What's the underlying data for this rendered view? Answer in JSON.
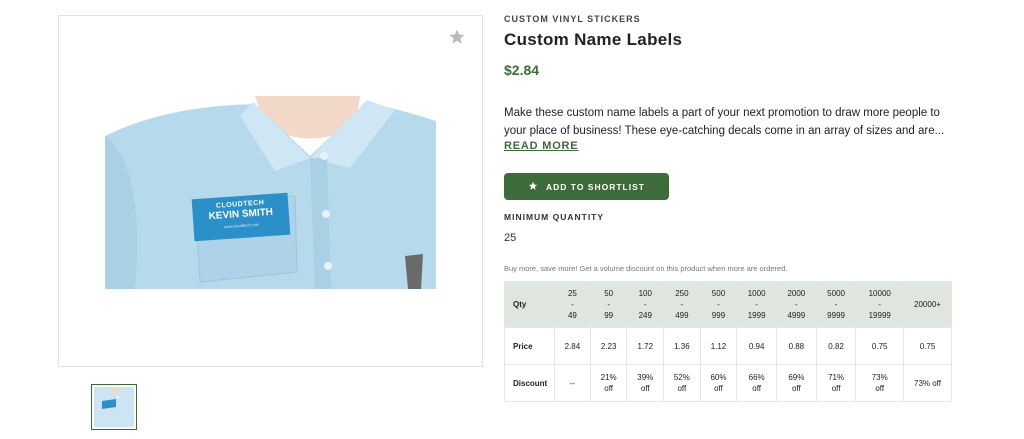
{
  "product": {
    "category": "CUSTOM VINYL STICKERS",
    "title": "Custom Name Labels",
    "price": "$2.84",
    "description_line1": "Make these custom name labels a part of your next promotion to draw more people to",
    "description_line2": "your place of business! These eye-catching decals come in an array of sizes and are...",
    "read_more": "READ MORE",
    "shortlist_label": "ADD TO SHORTLIST",
    "min_qty_label": "MINIMUM QUANTITY",
    "min_qty_value": "25",
    "volume_note": "Buy more, save more! Get a volume discount on this product when more are ordered."
  },
  "label_art": {
    "brand": "CLOUDTECH",
    "name": "KEVIN SMITH",
    "url": "www.cloudtech.com"
  },
  "pricing": {
    "headers": {
      "row_qty": "Qty",
      "row_price": "Price",
      "row_discount": "Discount"
    },
    "columns": [
      {
        "qty_a": "25",
        "qty_sep": "-",
        "qty_b": "49",
        "price": "2.84",
        "discount_a": "--",
        "discount_b": ""
      },
      {
        "qty_a": "50",
        "qty_sep": "-",
        "qty_b": "99",
        "price": "2.23",
        "discount_a": "21%",
        "discount_b": "off"
      },
      {
        "qty_a": "100",
        "qty_sep": "-",
        "qty_b": "249",
        "price": "1.72",
        "discount_a": "39%",
        "discount_b": "off"
      },
      {
        "qty_a": "250",
        "qty_sep": "-",
        "qty_b": "499",
        "price": "1.36",
        "discount_a": "52%",
        "discount_b": "off"
      },
      {
        "qty_a": "500",
        "qty_sep": "-",
        "qty_b": "999",
        "price": "1.12",
        "discount_a": "60%",
        "discount_b": "off"
      },
      {
        "qty_a": "1000",
        "qty_sep": "-",
        "qty_b": "1999",
        "price": "0.94",
        "discount_a": "66%",
        "discount_b": "off"
      },
      {
        "qty_a": "2000",
        "qty_sep": "-",
        "qty_b": "4999",
        "price": "0.88",
        "discount_a": "69%",
        "discount_b": "off"
      },
      {
        "qty_a": "5000",
        "qty_sep": "-",
        "qty_b": "9999",
        "price": "0.82",
        "discount_a": "71%",
        "discount_b": "off"
      },
      {
        "qty_a": "10000",
        "qty_sep": "-",
        "qty_b": "19999",
        "price": "0.75",
        "discount_a": "73%",
        "discount_b": "off"
      }
    ],
    "last": {
      "qty": "20000+",
      "price": "0.75",
      "discount": "73% off"
    }
  },
  "icons": {
    "favorite": "star-icon",
    "shortlist": "star-icon"
  },
  "colors": {
    "accent": "#3d6b39",
    "table_header": "#dfe6df",
    "label_blue": "#2b8fc9"
  }
}
